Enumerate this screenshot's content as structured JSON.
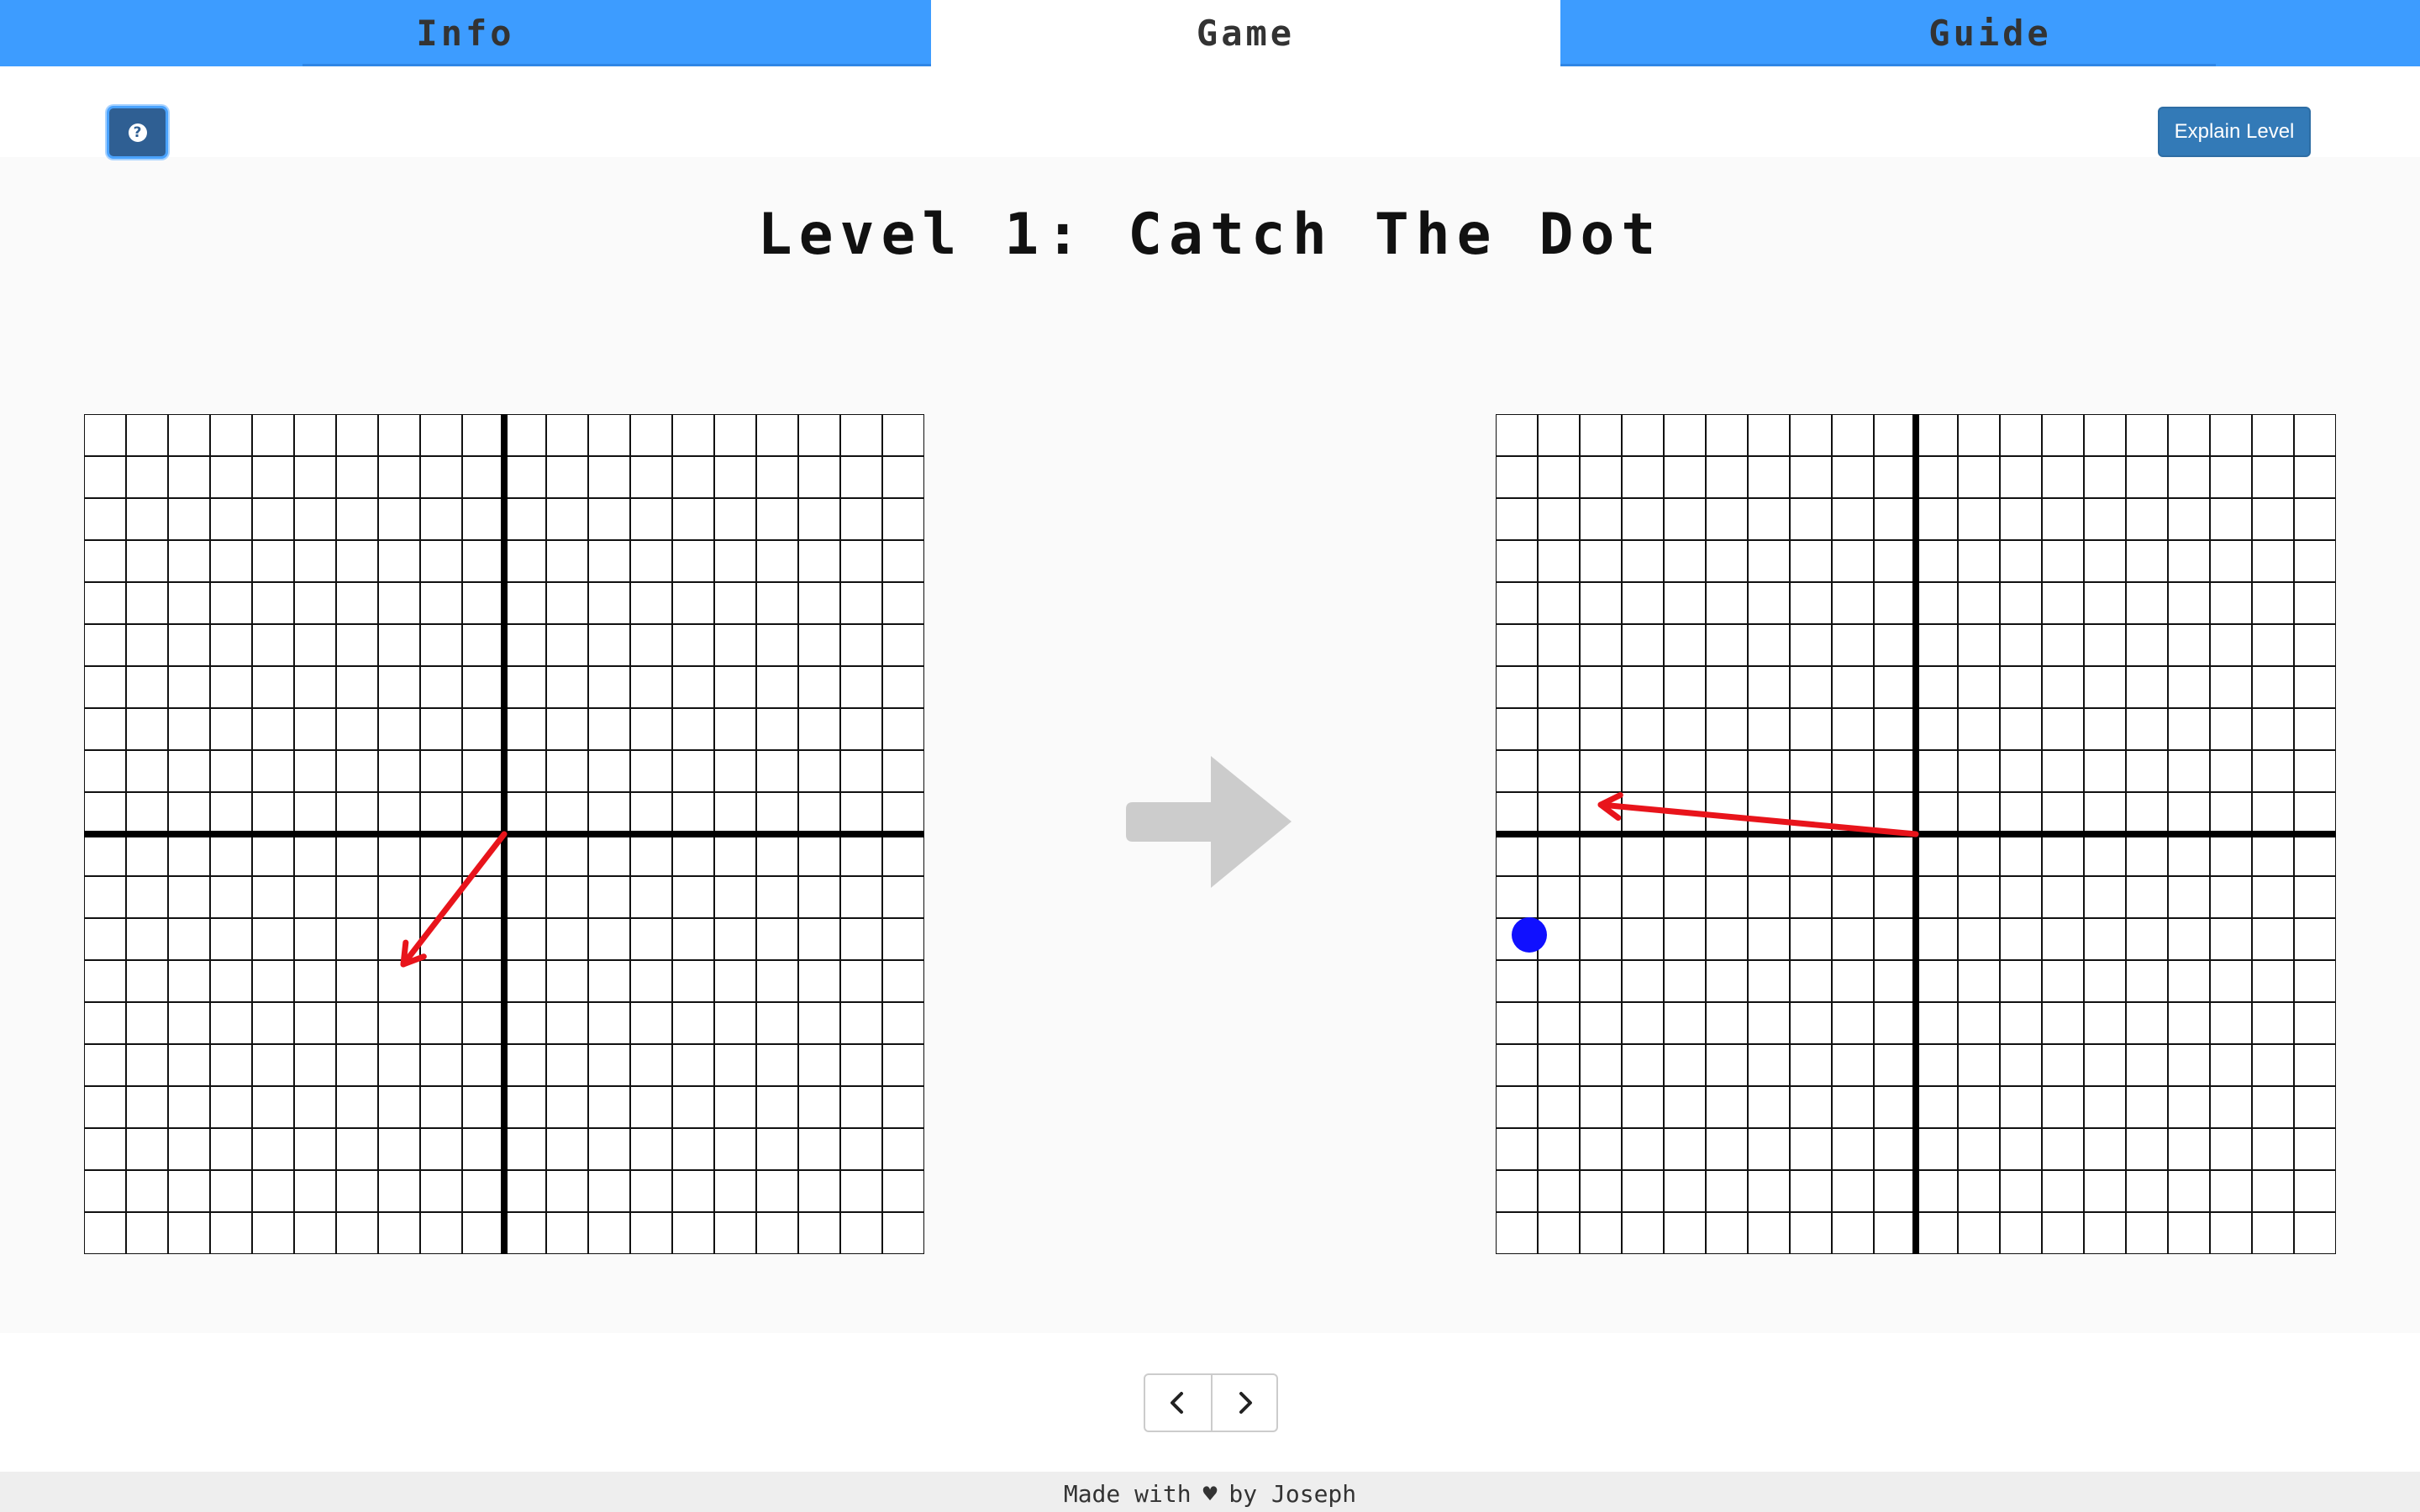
{
  "tabs": {
    "info": "Info",
    "game": "Game",
    "guide": "Guide",
    "active": "Game"
  },
  "toolbar": {
    "help_icon": "question-circle-icon",
    "help_glyph": "?",
    "explain_label": "Explain Level"
  },
  "level": {
    "title": "Level 1: Catch The Dot"
  },
  "left_grid": {
    "axis_range": [
      -10,
      10
    ],
    "vector": {
      "from": [
        0,
        0
      ],
      "to": [
        -2.4,
        -3.1
      ],
      "color": "#e8141b"
    }
  },
  "transform_arrow_icon": "arrow-right-icon",
  "right_grid": {
    "axis_range": [
      -10,
      10
    ],
    "vector": {
      "from": [
        0,
        0
      ],
      "to": [
        -7.5,
        0.7
      ],
      "color": "#e8141b"
    },
    "dot": {
      "at": [
        -9.2,
        -2.4
      ],
      "color": "#1010ff"
    }
  },
  "pager": {
    "prev_icon": "chevron-left-icon",
    "next_icon": "chevron-right-icon"
  },
  "footer": {
    "made_with": "Made with",
    "heart": "♥",
    "by": "by Joseph"
  },
  "colors": {
    "tab_bar": "#3d9cff",
    "explain_button": "#337ab7",
    "vector": "#e8141b",
    "dot": "#1010ff",
    "transform_arrow": "#cccccc"
  }
}
